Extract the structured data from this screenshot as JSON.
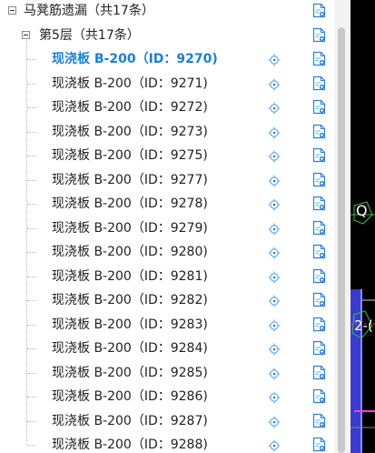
{
  "tree": {
    "root": {
      "label": "马凳筋遗漏（共17条）"
    },
    "floor": {
      "label": "第5层（共17条）"
    },
    "items": [
      {
        "label": "现浇板 B-200（ID：9270)",
        "selected": true
      },
      {
        "label": "现浇板 B-200（ID：9271)",
        "selected": false
      },
      {
        "label": "现浇板 B-200（ID：9272)",
        "selected": false
      },
      {
        "label": "现浇板 B-200（ID：9273)",
        "selected": false
      },
      {
        "label": "现浇板 B-200（ID：9275)",
        "selected": false
      },
      {
        "label": "现浇板 B-200（ID：9277)",
        "selected": false
      },
      {
        "label": "现浇板 B-200（ID：9278)",
        "selected": false
      },
      {
        "label": "现浇板 B-200（ID：9279)",
        "selected": false
      },
      {
        "label": "现浇板 B-200（ID：9280)",
        "selected": false
      },
      {
        "label": "现浇板 B-200（ID：9281)",
        "selected": false
      },
      {
        "label": "现浇板 B-200（ID：9282)",
        "selected": false
      },
      {
        "label": "现浇板 B-200（ID：9283)",
        "selected": false
      },
      {
        "label": "现浇板 B-200（ID：9284)",
        "selected": false
      },
      {
        "label": "现浇板 B-200（ID：9285)",
        "selected": false
      },
      {
        "label": "现浇板 B-200（ID：9286)",
        "selected": false
      },
      {
        "label": "现浇板 B-200（ID：9287)",
        "selected": false
      },
      {
        "label": "现浇板 B-200（ID：9288)",
        "selected": false
      }
    ],
    "icons": {
      "locate": "locate-crosshair-icon",
      "report": "report-document-icon"
    }
  },
  "cad": {
    "labels": [
      {
        "text": "Q"
      },
      {
        "text": "2-("
      }
    ]
  },
  "colors": {
    "selected_text": "#1a7fd4",
    "icon_blue": "#2f7fd8",
    "icon_blue_light": "#6fb0ef",
    "canvas_background": "#000000",
    "cad_green": "#39c139",
    "cad_blue": "#3a3acf",
    "cad_magenta": "#ff3fd0"
  }
}
